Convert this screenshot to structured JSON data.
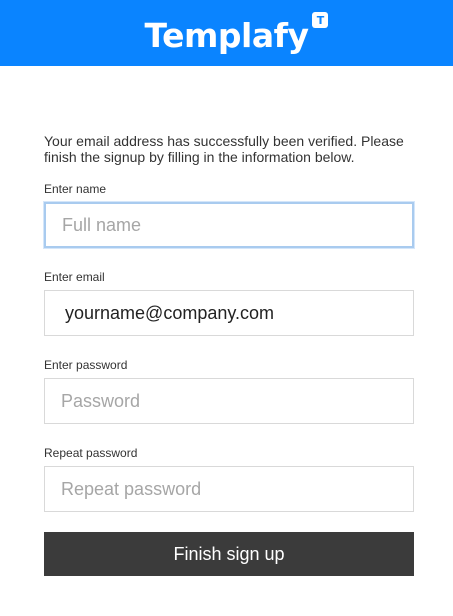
{
  "header": {
    "logo_text": "Templafy",
    "logo_badge": "T",
    "background_color": "#0a84ff"
  },
  "intro": {
    "message": "Your email address has successfully been verified. Please finish the signup by filling in the information below."
  },
  "form": {
    "name": {
      "label": "Enter name",
      "placeholder": "Full name",
      "value": ""
    },
    "email": {
      "label": "Enter email",
      "placeholder": "",
      "value": "yourname@company.com"
    },
    "password": {
      "label": "Enter password",
      "placeholder": "Password",
      "value": ""
    },
    "repeat_password": {
      "label": "Repeat password",
      "placeholder": "Repeat password",
      "value": ""
    },
    "submit_label": "Finish sign up"
  }
}
